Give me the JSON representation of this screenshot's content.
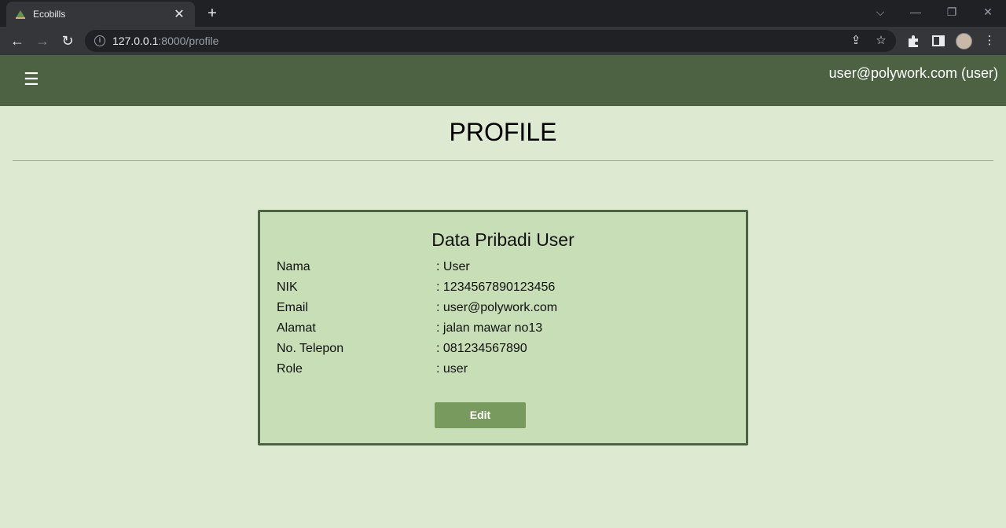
{
  "browser": {
    "tab_title": "Ecobills",
    "tab_close": "✕",
    "new_tab": "+",
    "url_host": "127.0.0.1",
    "url_path": ":8000/profile",
    "controls": {
      "dropdown": "⌵",
      "minimize": "—",
      "restore": "❐",
      "close": "✕"
    }
  },
  "header": {
    "menu_icon": "☰",
    "user": "user@polywork.com (user)"
  },
  "page": {
    "title": "PROFILE"
  },
  "profile_card": {
    "title": "Data Pribadi User",
    "rows": [
      {
        "label": "Nama",
        "value": ": User"
      },
      {
        "label": "NIK",
        "value": ": 1234567890123456"
      },
      {
        "label": "Email",
        "value": ": user@polywork.com"
      },
      {
        "label": "Alamat",
        "value": ": jalan mawar no13"
      },
      {
        "label": "No. Telepon",
        "value": ": 081234567890"
      },
      {
        "label": "Role",
        "value": ": user"
      }
    ],
    "edit_label": "Edit"
  },
  "colors": {
    "header_bg": "#4d6243",
    "page_bg": "#dde9d1",
    "card_bg": "#c7deb6",
    "button_bg": "#799a5f"
  },
  "icons": [
    "app-favicon-icon",
    "info-icon",
    "share-icon",
    "star-icon",
    "puzzle-icon",
    "sidepanel-icon",
    "kebab-menu-icon",
    "hamburger-icon"
  ]
}
